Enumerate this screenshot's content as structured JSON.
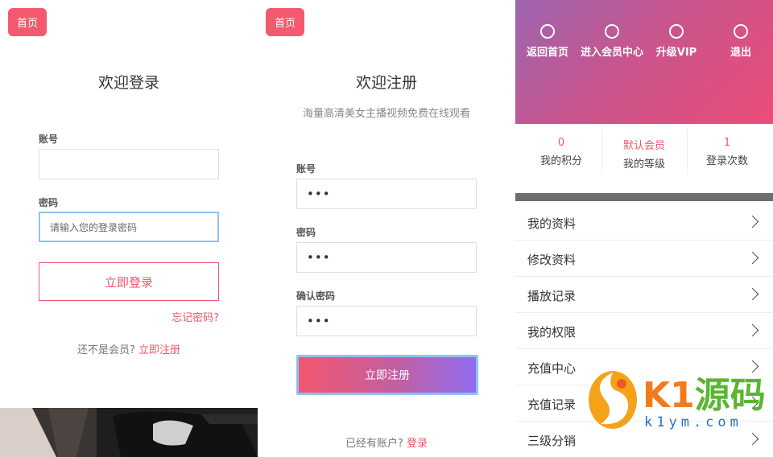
{
  "login": {
    "home": "首页",
    "title": "欢迎登录",
    "account_label": "账号",
    "password_label": "密码",
    "password_placeholder": "请输入您的登录密码",
    "submit": "立即登录",
    "forgot": "忘记密码?",
    "not_member": "还不是会员?",
    "register_link": "立即注册"
  },
  "register": {
    "home": "首页",
    "title": "欢迎注册",
    "subtitle": "海量高清美女主播视频免费在线观看",
    "account_label": "账号",
    "password_label": "密码",
    "confirm_label": "确认密码",
    "account_value": "•••",
    "password_value": "•••",
    "confirm_value": "•••",
    "submit": "立即注册",
    "have_account": "已经有账户?",
    "login_link": "登录"
  },
  "member": {
    "nav": [
      {
        "label": "返回首页"
      },
      {
        "label": "进入会员中心"
      },
      {
        "label": "升级VIP"
      },
      {
        "label": "退出"
      }
    ],
    "stats": [
      {
        "value": "0",
        "label": "我的积分"
      },
      {
        "value": "默认会员",
        "label": "我的等级"
      },
      {
        "value": "1",
        "label": "登录次数"
      }
    ],
    "menu": [
      {
        "label": "我的资料"
      },
      {
        "label": "修改资料"
      },
      {
        "label": "播放记录"
      },
      {
        "label": "我的权限"
      },
      {
        "label": "充值中心"
      },
      {
        "label": "充值记录"
      },
      {
        "label": "三级分销"
      }
    ]
  },
  "watermark": {
    "brand_k1": "K1",
    "brand_cn": "源码",
    "domain": "k1ym.com"
  },
  "colors": {
    "accent": "#f0566c",
    "focus_border": "#8ec2f5",
    "header_gradient": [
      "#9c65b0",
      "#ea4d78"
    ],
    "button_gradient": [
      "#f3566e",
      "#8f6cf0"
    ]
  }
}
